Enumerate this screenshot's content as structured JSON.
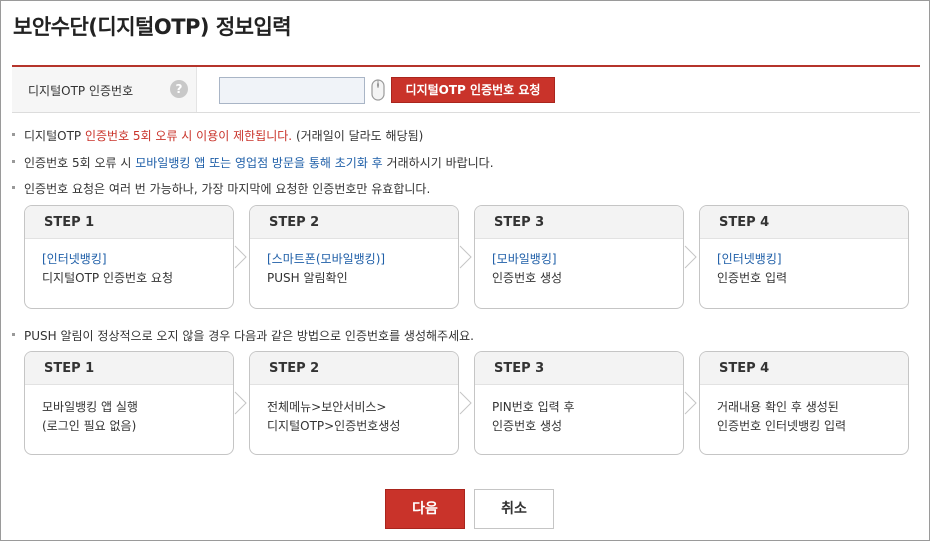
{
  "page": {
    "title": "보안수단(디지털OTP) 정보입력"
  },
  "form": {
    "label": "디지털OTP 인증번호",
    "help_icon": "?",
    "input_value": "",
    "input_placeholder": "",
    "request_button": "디지털OTP 인증번호 요청"
  },
  "notices": [
    {
      "a": "디지털OTP ",
      "b": "인증번호 5회 오류 시 이용이 제한됩니다.",
      "c": " (거래일이 달라도 해당됨)"
    },
    {
      "a": "인증번호 5회 오류 시 ",
      "b": "모바일뱅킹 앱 또는 영업점 방문을 통해 초기화 후",
      "c": " 거래하시기 바랍니다."
    },
    {
      "a": "인증번호 요청은 여러 번 가능하나, 가장 마지막에 요청한 인증번호만 유효합니다."
    }
  ],
  "steps_a": [
    {
      "head": "STEP 1",
      "line1": "[인터넷뱅킹]",
      "line2": "디지털OTP 인증번호 요청"
    },
    {
      "head": "STEP 2",
      "line1": "[스마트폰(모바일뱅킹)]",
      "line2": "PUSH 알림확인"
    },
    {
      "head": "STEP 3",
      "line1": "[모바일뱅킹]",
      "line2": "인증번호 생성"
    },
    {
      "head": "STEP 4",
      "line1": "[인터넷뱅킹]",
      "line2": "인증번호 입력"
    }
  ],
  "push_notice": "PUSH 알림이 정상적으로 오지 않을 경우 다음과 같은 방법으로 인증번호를 생성해주세요.",
  "steps_b": [
    {
      "head": "STEP 1",
      "line1": "모바일뱅킹 앱 실행",
      "line2": "(로그인 필요 없음)"
    },
    {
      "head": "STEP 2",
      "line1": "전체메뉴>보안서비스>",
      "line2": "디지털OTP>인증번호생성"
    },
    {
      "head": "STEP 3",
      "line1": "PIN번호 입력 후",
      "line2": "인증번호 생성"
    },
    {
      "head": "STEP 4",
      "line1": "거래내용 확인 후 생성된",
      "line2": "인증번호 인터넷뱅킹 입력"
    }
  ],
  "buttons": {
    "next": "다음",
    "cancel": "취소"
  },
  "colors": {
    "accent": "#c9332a",
    "link": "#1f5fa8"
  },
  "icons": {
    "help": "question-circle-icon",
    "mouse": "mouse-icon",
    "arrow": "chevron-right-icon"
  }
}
